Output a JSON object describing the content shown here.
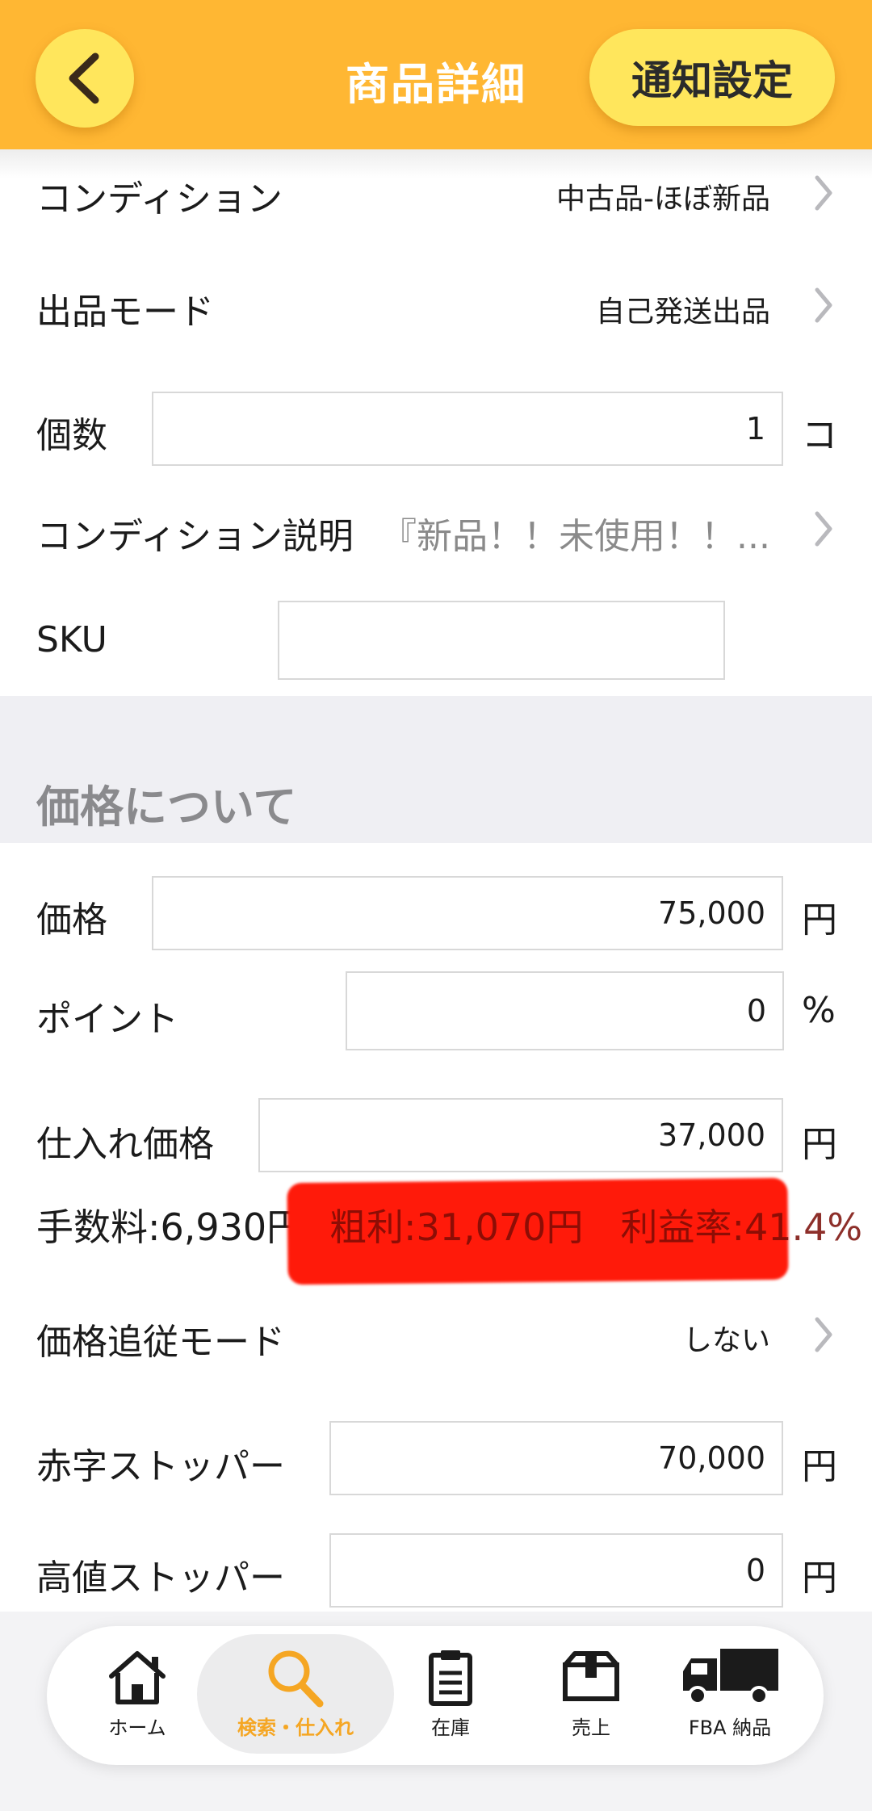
{
  "header": {
    "title": "商品詳細",
    "notify_label": "通知設定"
  },
  "listing": {
    "condition": {
      "label": "コンディション",
      "value": "中古品-ほぼ新品"
    },
    "mode": {
      "label": "出品モード",
      "value": "自己発送出品"
    },
    "quantity": {
      "label": "個数",
      "value": "1",
      "unit": "コ"
    },
    "condition_note": {
      "label": "コンディション説明",
      "value": "『新品！！未使用！！..."
    },
    "sku": {
      "label": "SKU",
      "value": ""
    }
  },
  "pricing": {
    "section_title": "価格について",
    "price": {
      "label": "価格",
      "value": "75,000",
      "unit": "円"
    },
    "point": {
      "label": "ポイント",
      "value": "0",
      "unit": "%"
    },
    "purchase_price": {
      "label": "仕入れ価格",
      "value": "37,000",
      "unit": "円"
    },
    "fee_text": "手数料:6,930円",
    "profit_text": "粗利:31,070円　利益率:41.4%",
    "tracking_mode": {
      "label": "価格追従モード",
      "value": "しない"
    },
    "loss_stopper": {
      "label": "赤字ストッパー",
      "value": "70,000",
      "unit": "円"
    },
    "high_stopper": {
      "label": "高値ストッパー",
      "value": "0",
      "unit": "円"
    }
  },
  "tabs": [
    {
      "label": "ホーム",
      "icon": "home-icon",
      "active": false
    },
    {
      "label": "検索・仕入れ",
      "icon": "search-icon",
      "active": true
    },
    {
      "label": "在庫",
      "icon": "clipboard-icon",
      "active": false
    },
    {
      "label": "売上",
      "icon": "box-icon",
      "active": false
    },
    {
      "label": "FBA 納品",
      "icon": "truck-icon",
      "active": false
    }
  ],
  "colors": {
    "header": "#ffb733",
    "button": "#ffe65c",
    "active_tab": "#f5a623",
    "redaction": "#ff1a0a"
  }
}
